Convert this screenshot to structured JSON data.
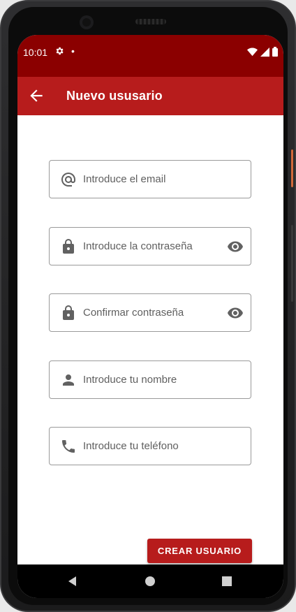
{
  "status_bar": {
    "time": "10:01",
    "settings_icon": "settings-icon",
    "notification_dot": "•",
    "right_icons": [
      "wifi-icon",
      "cellular-signal-icon",
      "battery-icon"
    ]
  },
  "app_bar": {
    "title": "Nuevo ususario",
    "back_icon": "arrow-back-icon",
    "color": "#b71c1c"
  },
  "form": {
    "fields": [
      {
        "icon": "at-sign-icon",
        "placeholder": "Introduce el email",
        "value": ""
      },
      {
        "icon": "lock-icon",
        "placeholder": "Introduce la contraseña",
        "value": "",
        "trailing_icon": "eye-icon"
      },
      {
        "icon": "lock-icon",
        "placeholder": "Confirmar contraseña",
        "value": "",
        "trailing_icon": "eye-icon"
      },
      {
        "icon": "person-icon",
        "placeholder": "Introduce tu nombre",
        "value": ""
      },
      {
        "icon": "phone-icon",
        "placeholder": "Introduce tu teléfono",
        "value": ""
      }
    ]
  },
  "actions": {
    "submit_label": "CREAR USUARIO"
  },
  "nav_bar": {
    "items": [
      "back-triangle-icon",
      "home-circle-icon",
      "recents-square-icon"
    ]
  },
  "colors": {
    "status_bar": "#8b0000",
    "primary": "#b71c1c",
    "icon_gray": "#616161"
  }
}
